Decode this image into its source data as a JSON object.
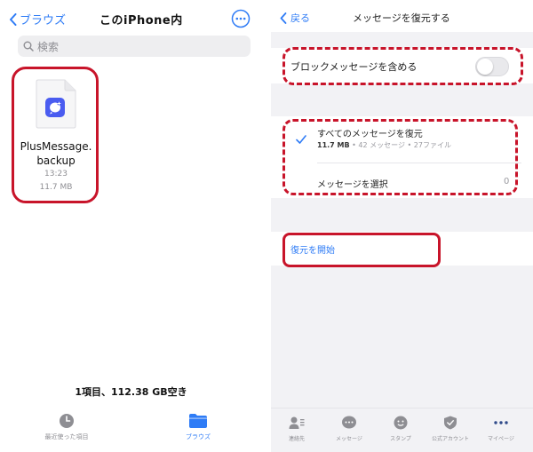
{
  "left_panel": {
    "nav": {
      "back_label": "ブラウズ",
      "title": "このiPhone内"
    },
    "search": {
      "placeholder": "検索"
    },
    "file": {
      "name_line1": "PlusMessage.",
      "name_line2": "backup",
      "time": "13:23",
      "size": "11.7 MB"
    },
    "storage_text": "1項目、112.38 GB空き",
    "tabs": [
      {
        "label": "最近使った項目",
        "icon": "clock-icon",
        "active": false
      },
      {
        "label": "ブラウズ",
        "icon": "folder-icon",
        "active": true
      }
    ]
  },
  "right_panel": {
    "nav": {
      "back_label": "戻る",
      "title": "メッセージを復元する"
    },
    "block_messages": {
      "label": "ブロックメッセージを含める",
      "enabled": false
    },
    "restore_all": {
      "label": "すべてのメッセージを復元",
      "size": "11.7 MB",
      "detail": " • 42 メッセージ • 27ファイル",
      "checked": true
    },
    "select_messages": {
      "label": "メッセージを選択",
      "count": "0"
    },
    "start_restore_label": "復元を開始",
    "tabs": [
      {
        "label": "連絡先",
        "icon": "contacts-icon"
      },
      {
        "label": "メッセージ",
        "icon": "message-icon"
      },
      {
        "label": "スタンプ",
        "icon": "smiley-icon"
      },
      {
        "label": "公式アカウント",
        "icon": "shield-check-icon"
      },
      {
        "label": "マイページ",
        "icon": "more-icon"
      }
    ]
  },
  "colors": {
    "accent": "#2f7cf6",
    "highlight": "#c8142a",
    "app_icon": "#4a5cf0"
  }
}
